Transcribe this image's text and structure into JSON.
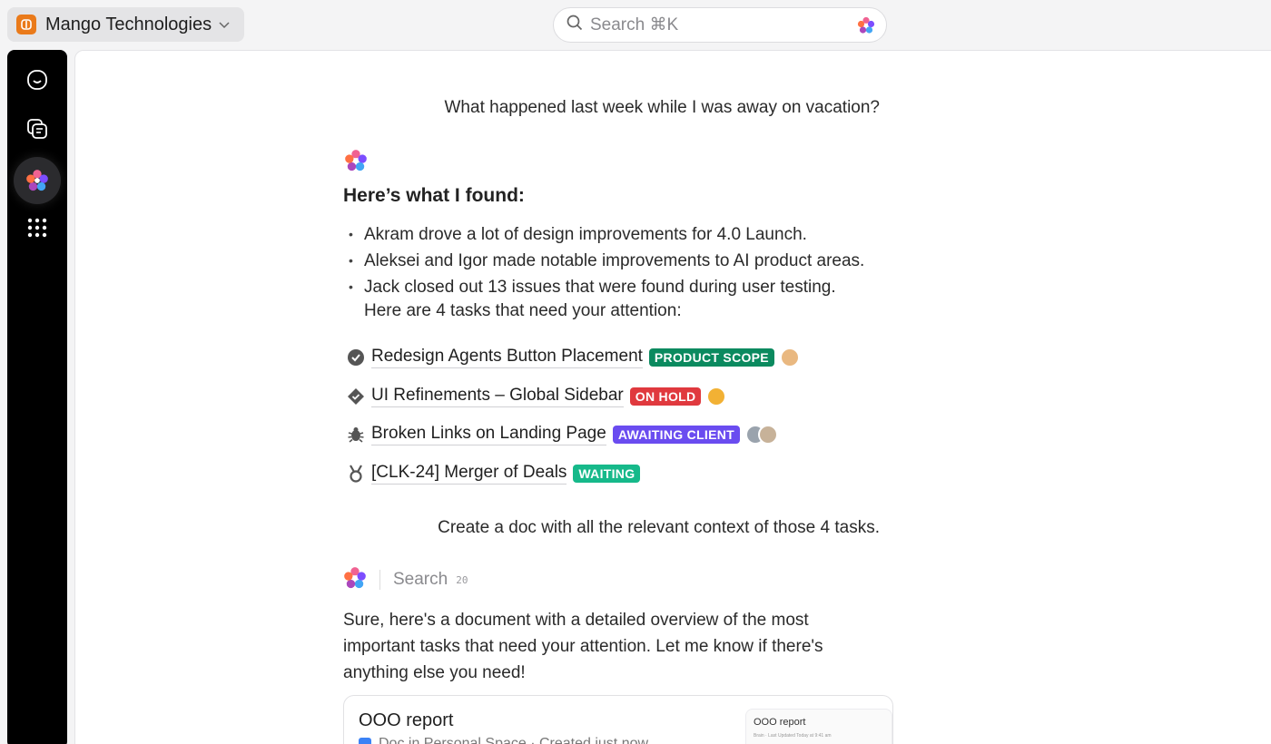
{
  "workspace": {
    "name": "Mango Technologies"
  },
  "search": {
    "placeholder": "Search ⌘K"
  },
  "sidebar": {
    "items": [
      "home-icon",
      "chat-icon",
      "ai-brain-icon",
      "apps-grid-icon"
    ],
    "active": "ai-brain-icon"
  },
  "conversation": {
    "question": "What happened last week while I was away on vacation?",
    "heading": "Here’s what I found:",
    "bullets": [
      "Akram drove a lot of design improvements for 4.0 Launch.",
      "Aleksei and Igor made notable improvements to AI product areas.",
      "Jack closed out 13 issues that were found during user testing."
    ],
    "attention": "Here are 4 tasks that need your attention:",
    "tasks": [
      {
        "title": "Redesign Agents Button Placement",
        "status": "PRODUCT SCOPE",
        "status_color": "#0b8a5f",
        "icon": "check-circle-icon"
      },
      {
        "title": "UI Refinements – Global Sidebar",
        "status": "ON HOLD",
        "status_color": "#e0393e",
        "icon": "diamond-check-icon"
      },
      {
        "title": "Broken Links on Landing Page",
        "status": "AWAITING CLIENT",
        "status_color": "#6a4cf0",
        "icon": "bug-icon"
      },
      {
        "title": "[CLK-24] Merger of Deals",
        "status": "WAITING",
        "status_color": "#16b98a",
        "icon": "medal-icon"
      }
    ],
    "followup": "Create a doc with all the relevant context of those 4 tasks.",
    "step": {
      "label": "Search",
      "count": "20"
    },
    "reply": "Sure, here's a document with a detailed overview of the most important tasks that need your attention. Let me know if there's anything else you need!",
    "doc": {
      "title": "OOO report",
      "meta": "Doc in Personal Space · Created just now",
      "preview_title": "OOO report",
      "preview_line": "Brain · Last Updated Today at 9:41 am"
    }
  },
  "colors": {
    "accent_orange": "#ea7a1a",
    "sidebar_bg": "#000000",
    "link_underline": "#d0d0d4"
  }
}
